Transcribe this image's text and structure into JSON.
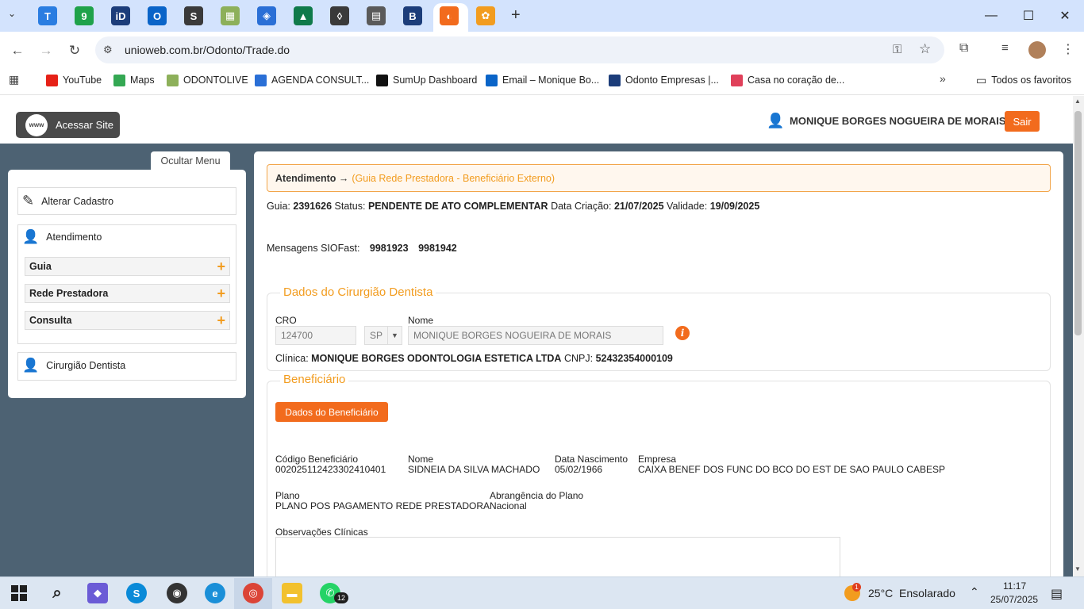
{
  "browser": {
    "url": "unioweb.com.br/Odonto/Trade.do",
    "tabs": [
      {
        "icon": "tooth-icon",
        "color": "#2a7de1",
        "glyph": "T"
      },
      {
        "icon": "nine-icon",
        "color": "#1fa24a",
        "glyph": "9"
      },
      {
        "icon": "idoc-icon",
        "color": "#1c3d7a",
        "glyph": "iD"
      },
      {
        "icon": "outlook-icon",
        "color": "#0a64c8",
        "glyph": "O"
      },
      {
        "icon": "s-script-icon",
        "color": "#3a3a3a",
        "glyph": "S"
      },
      {
        "icon": "blocks-icon",
        "color": "#8db05a",
        "glyph": "▦"
      },
      {
        "icon": "shield-icon",
        "color": "#2a6fd6",
        "glyph": "◈"
      },
      {
        "icon": "building-icon",
        "color": "#0f7a4a",
        "glyph": "▲"
      },
      {
        "icon": "tooth-outline-icon",
        "color": "#3a3a3a",
        "glyph": "◊"
      },
      {
        "icon": "chart-icon",
        "color": "#5a5a5a",
        "glyph": "▤"
      },
      {
        "icon": "b-logo-icon",
        "color": "#1c3d7a",
        "glyph": "B"
      },
      {
        "icon": "swirl-icon",
        "color": "#f26b1d",
        "glyph": "◐"
      },
      {
        "icon": "flower-icon",
        "color": "#f29c1f",
        "glyph": "✿"
      }
    ]
  },
  "bookmarks": [
    {
      "label": "YouTube",
      "color": "#e62117",
      "icon": "youtube-icon"
    },
    {
      "label": "Maps",
      "color": "#34a853",
      "icon": "maps-icon"
    },
    {
      "label": "ODONTOLIVE",
      "color": "#8db05a",
      "icon": "odontolive-icon"
    },
    {
      "label": "AGENDA CONSULT...",
      "color": "#2a6fd6",
      "icon": "grid-icon"
    },
    {
      "label": "SumUp Dashboard",
      "color": "#111111",
      "icon": "sumup-icon"
    },
    {
      "label": "Email – Monique Bo...",
      "color": "#0a64c8",
      "icon": "outlook-icon"
    },
    {
      "label": "Odonto Empresas |...",
      "color": "#1c3d7a",
      "icon": "odonto-empresas-icon"
    },
    {
      "label": "Casa no coração de...",
      "color": "#e0405a",
      "icon": "airbnb-icon"
    }
  ],
  "all_bookmarks": "Todos os favoritos",
  "header": {
    "site_button": "Acessar Site",
    "www": "www",
    "user": "MONIQUE BORGES NOGUEIRA DE MORAIS",
    "logout": "Sair"
  },
  "sidebar": {
    "toggle": "Ocultar Menu",
    "edit": "Alterar Cadastro",
    "attendance": "Atendimento",
    "subs": [
      "Guia",
      "Rede Prestadora",
      "Consulta"
    ],
    "dentist": "Cirurgião Dentista"
  },
  "main": {
    "breadcrumb_main": "Atendimento →",
    "breadcrumb_sub": "(Guia Rede Prestadora - Beneficiário Externo)",
    "guide_label": "Guia:",
    "guide": "2391626",
    "status_label": "Status:",
    "status": "PENDENTE DE ATO COMPLEMENTAR",
    "created_label": "Data Criação:",
    "created": "21/07/2025",
    "valid_label": "Validade:",
    "valid": "19/09/2025",
    "messages_label": "Mensagens SIOFast:",
    "message1": "9981923",
    "message2": "9981942",
    "dentist_legend": "Dados do Cirurgião Dentista",
    "cro_label": "CRO",
    "cro": "124700",
    "uf": "SP",
    "name_label": "Nome",
    "name": "MONIQUE BORGES NOGUEIRA DE MORAIS",
    "clinic_label": "Clínica:",
    "clinic": "MONIQUE BORGES ODONTOLOGIA ESTETICA LTDA",
    "cnpj_label": "CNPJ:",
    "cnpj": "52432354000109",
    "beneficiary_legend": "Beneficiário",
    "beneficiary_button": "Dados do Beneficiário",
    "code_label": "Código Beneficiário",
    "code": "002025112423302410401",
    "bname_label": "Nome",
    "bname": "SIDNEIA DA SILVA MACHADO",
    "birth_label": "Data Nascimento",
    "birth": "05/02/1966",
    "company_label": "Empresa",
    "company": "CAIXA BENEF DOS FUNC DO BCO DO EST DE SAO PAULO CABESP",
    "plan_label": "Plano",
    "plan": "PLANO POS PAGAMENTO REDE PRESTADORA",
    "scope_label": "Abrangência do Plano",
    "scope": "Nacional",
    "obs_label": "Observações Clínicas"
  },
  "taskbar": {
    "weather": "25°C  Ensolarado",
    "time": "11:17",
    "date": "25/07/2025",
    "whatsapp_badge": "12",
    "weather_badge": "1"
  }
}
